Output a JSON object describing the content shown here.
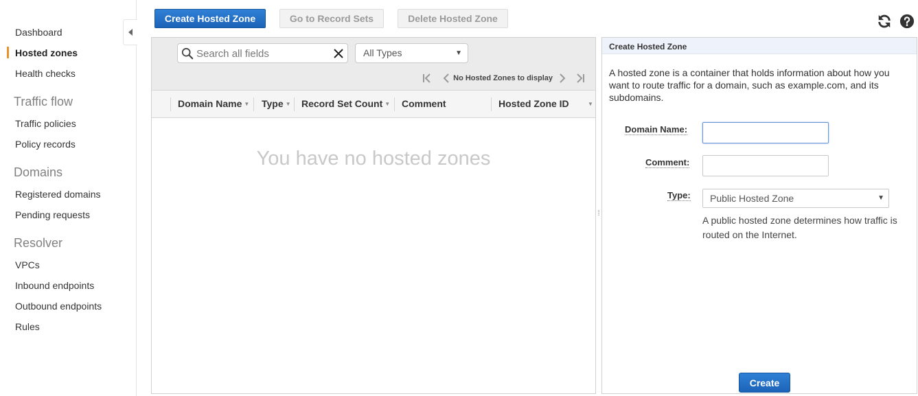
{
  "sidebar": {
    "items": [
      {
        "label": "Dashboard",
        "active": false
      },
      {
        "label": "Hosted zones",
        "active": true
      },
      {
        "label": "Health checks",
        "active": false
      }
    ],
    "sections": [
      {
        "title": "Traffic flow",
        "items": [
          {
            "label": "Traffic policies"
          },
          {
            "label": "Policy records"
          }
        ]
      },
      {
        "title": "Domains",
        "items": [
          {
            "label": "Registered domains"
          },
          {
            "label": "Pending requests"
          }
        ]
      },
      {
        "title": "Resolver",
        "items": [
          {
            "label": "VPCs"
          },
          {
            "label": "Inbound endpoints"
          },
          {
            "label": "Outbound endpoints"
          },
          {
            "label": "Rules"
          }
        ]
      }
    ],
    "accent_color": "#e8912d"
  },
  "toolbar": {
    "create_label": "Create Hosted Zone",
    "goto_label": "Go to Record Sets",
    "delete_label": "Delete Hosted Zone",
    "icons": [
      "refresh-icon",
      "help-icon"
    ]
  },
  "list": {
    "search_placeholder": "Search all fields",
    "type_filter": "All Types",
    "pager_text": "No Hosted Zones to display",
    "columns": [
      "Domain Name",
      "Type",
      "Record Set Count",
      "Comment",
      "Hosted Zone ID"
    ],
    "empty_message": "You have no hosted zones"
  },
  "form": {
    "title": "Create Hosted Zone",
    "description": "A hosted zone is a container that holds information about how you want to route traffic for a domain, such as example.com, and its subdomains.",
    "domain_label": "Domain Name:",
    "domain_value": "",
    "comment_label": "Comment:",
    "comment_value": "",
    "type_label": "Type:",
    "type_value": "Public Hosted Zone",
    "type_help": "A public hosted zone determines how traffic is routed on the Internet.",
    "submit_label": "Create"
  },
  "colors": {
    "primary_button": "#1c63b8",
    "disabled_button_text": "#9a9a9a"
  }
}
